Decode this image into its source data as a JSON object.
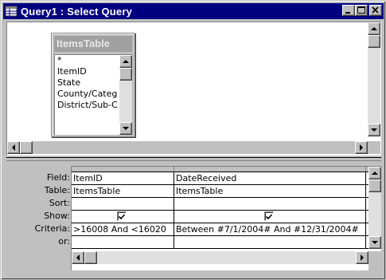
{
  "window": {
    "title": "Query1 : Select Query",
    "title_bar_color": "#000080",
    "buttons": [
      "minimize",
      "maximize",
      "close"
    ]
  },
  "field_list": {
    "table_name": "ItemsTable",
    "fields": [
      "*",
      "ItemID",
      "State",
      "County/Categ",
      "District/Sub-C"
    ]
  },
  "grid": {
    "row_labels": [
      "Field:",
      "Table:",
      "Sort:",
      "Show:",
      "Criteria:",
      "or:"
    ],
    "columns": [
      {
        "field": "ItemID",
        "table": "ItemsTable",
        "sort": "",
        "show": true,
        "criteria": ">16008 And <16020",
        "or": ""
      },
      {
        "field": "DateReceived",
        "table": "ItemsTable",
        "sort": "",
        "show": true,
        "criteria": "Between #7/1/2004# And #12/31/2004#",
        "or": ""
      }
    ]
  }
}
